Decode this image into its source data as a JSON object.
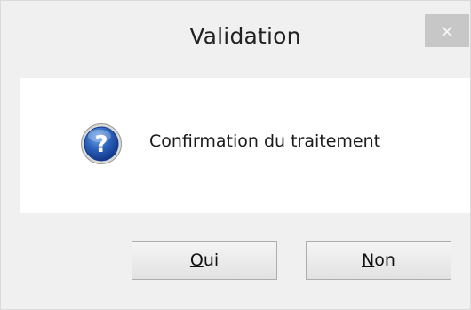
{
  "window": {
    "title": "Validation",
    "close_glyph": "×"
  },
  "content": {
    "icon": "question-icon",
    "message": "Confirmation du traitement"
  },
  "buttons": {
    "yes": {
      "mnemonic": "O",
      "rest": "ui"
    },
    "no": {
      "mnemonic": "N",
      "rest": "on"
    }
  },
  "colors": {
    "dialog_background": "#f0f0f0",
    "content_background": "#ffffff",
    "close_button": "#c7c7c7",
    "icon_blue": "#2453a6"
  }
}
